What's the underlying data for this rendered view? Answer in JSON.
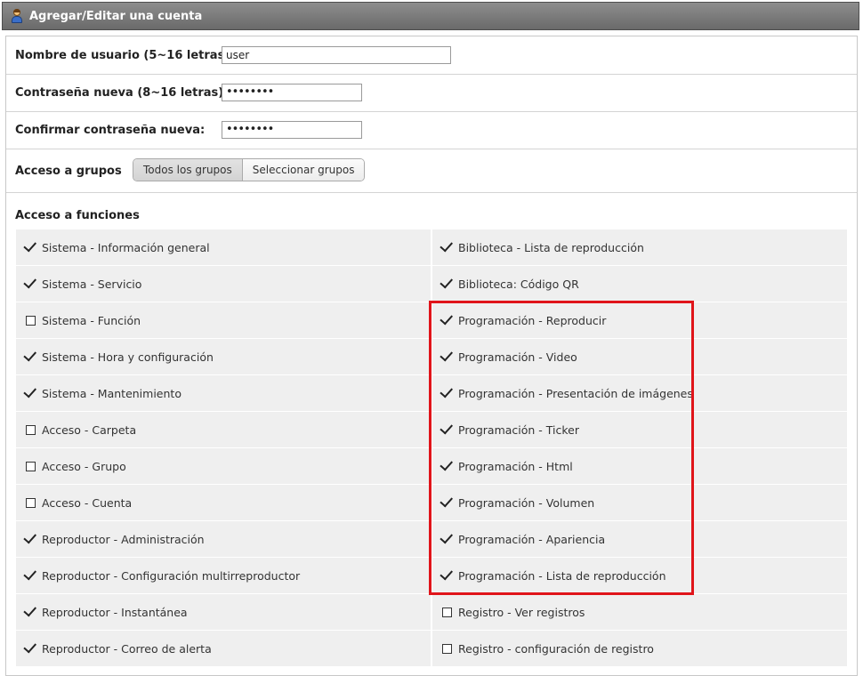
{
  "window": {
    "title": "Agregar/Editar una cuenta",
    "title_icon": "user-icon"
  },
  "form": {
    "username": {
      "label": "Nombre de usuario (5~16 letras):",
      "value": "user"
    },
    "new_password": {
      "label": "Contraseña nueva (8~16 letras):",
      "value": "••••••••"
    },
    "confirm_password": {
      "label": "Confirmar contraseña nueva:",
      "value": "••••••••"
    },
    "group_access": {
      "label": "Acceso a grupos",
      "options": [
        "Todos los grupos",
        "Seleccionar grupos"
      ],
      "selected": "Todos los grupos"
    },
    "function_access": {
      "label": "Acceso a funciones",
      "left": [
        {
          "label": "Sistema - Información general",
          "checked": true
        },
        {
          "label": "Sistema - Servicio",
          "checked": true
        },
        {
          "label": "Sistema - Función",
          "checked": false
        },
        {
          "label": "Sistema - Hora y configuración",
          "checked": true
        },
        {
          "label": "Sistema - Mantenimiento",
          "checked": true
        },
        {
          "label": "Acceso - Carpeta",
          "checked": false
        },
        {
          "label": "Acceso - Grupo",
          "checked": false
        },
        {
          "label": "Acceso - Cuenta",
          "checked": false
        },
        {
          "label": "Reproductor - Administración",
          "checked": true
        },
        {
          "label": "Reproductor - Configuración multirreproductor",
          "checked": true
        },
        {
          "label": "Reproductor - Instantánea",
          "checked": true
        },
        {
          "label": "Reproductor - Correo de alerta",
          "checked": true
        }
      ],
      "right": [
        {
          "label": "Biblioteca - Lista de reproducción",
          "checked": true
        },
        {
          "label": "Biblioteca: Código QR",
          "checked": true
        },
        {
          "label": "Programación - Reproducir",
          "checked": true
        },
        {
          "label": "Programación - Video",
          "checked": true
        },
        {
          "label": "Programación - Presentación de imágenes",
          "checked": true
        },
        {
          "label": "Programación - Ticker",
          "checked": true
        },
        {
          "label": "Programación - Html",
          "checked": true
        },
        {
          "label": "Programación - Volumen",
          "checked": true
        },
        {
          "label": "Programación - Apariencia",
          "checked": true
        },
        {
          "label": "Programación - Lista de reproducción",
          "checked": true
        },
        {
          "label": "Registro - Ver registros",
          "checked": false
        },
        {
          "label": "Registro - configuración de registro",
          "checked": false
        }
      ]
    }
  },
  "highlight": {
    "color": "#e0141a",
    "covers": "Programación permissions"
  }
}
